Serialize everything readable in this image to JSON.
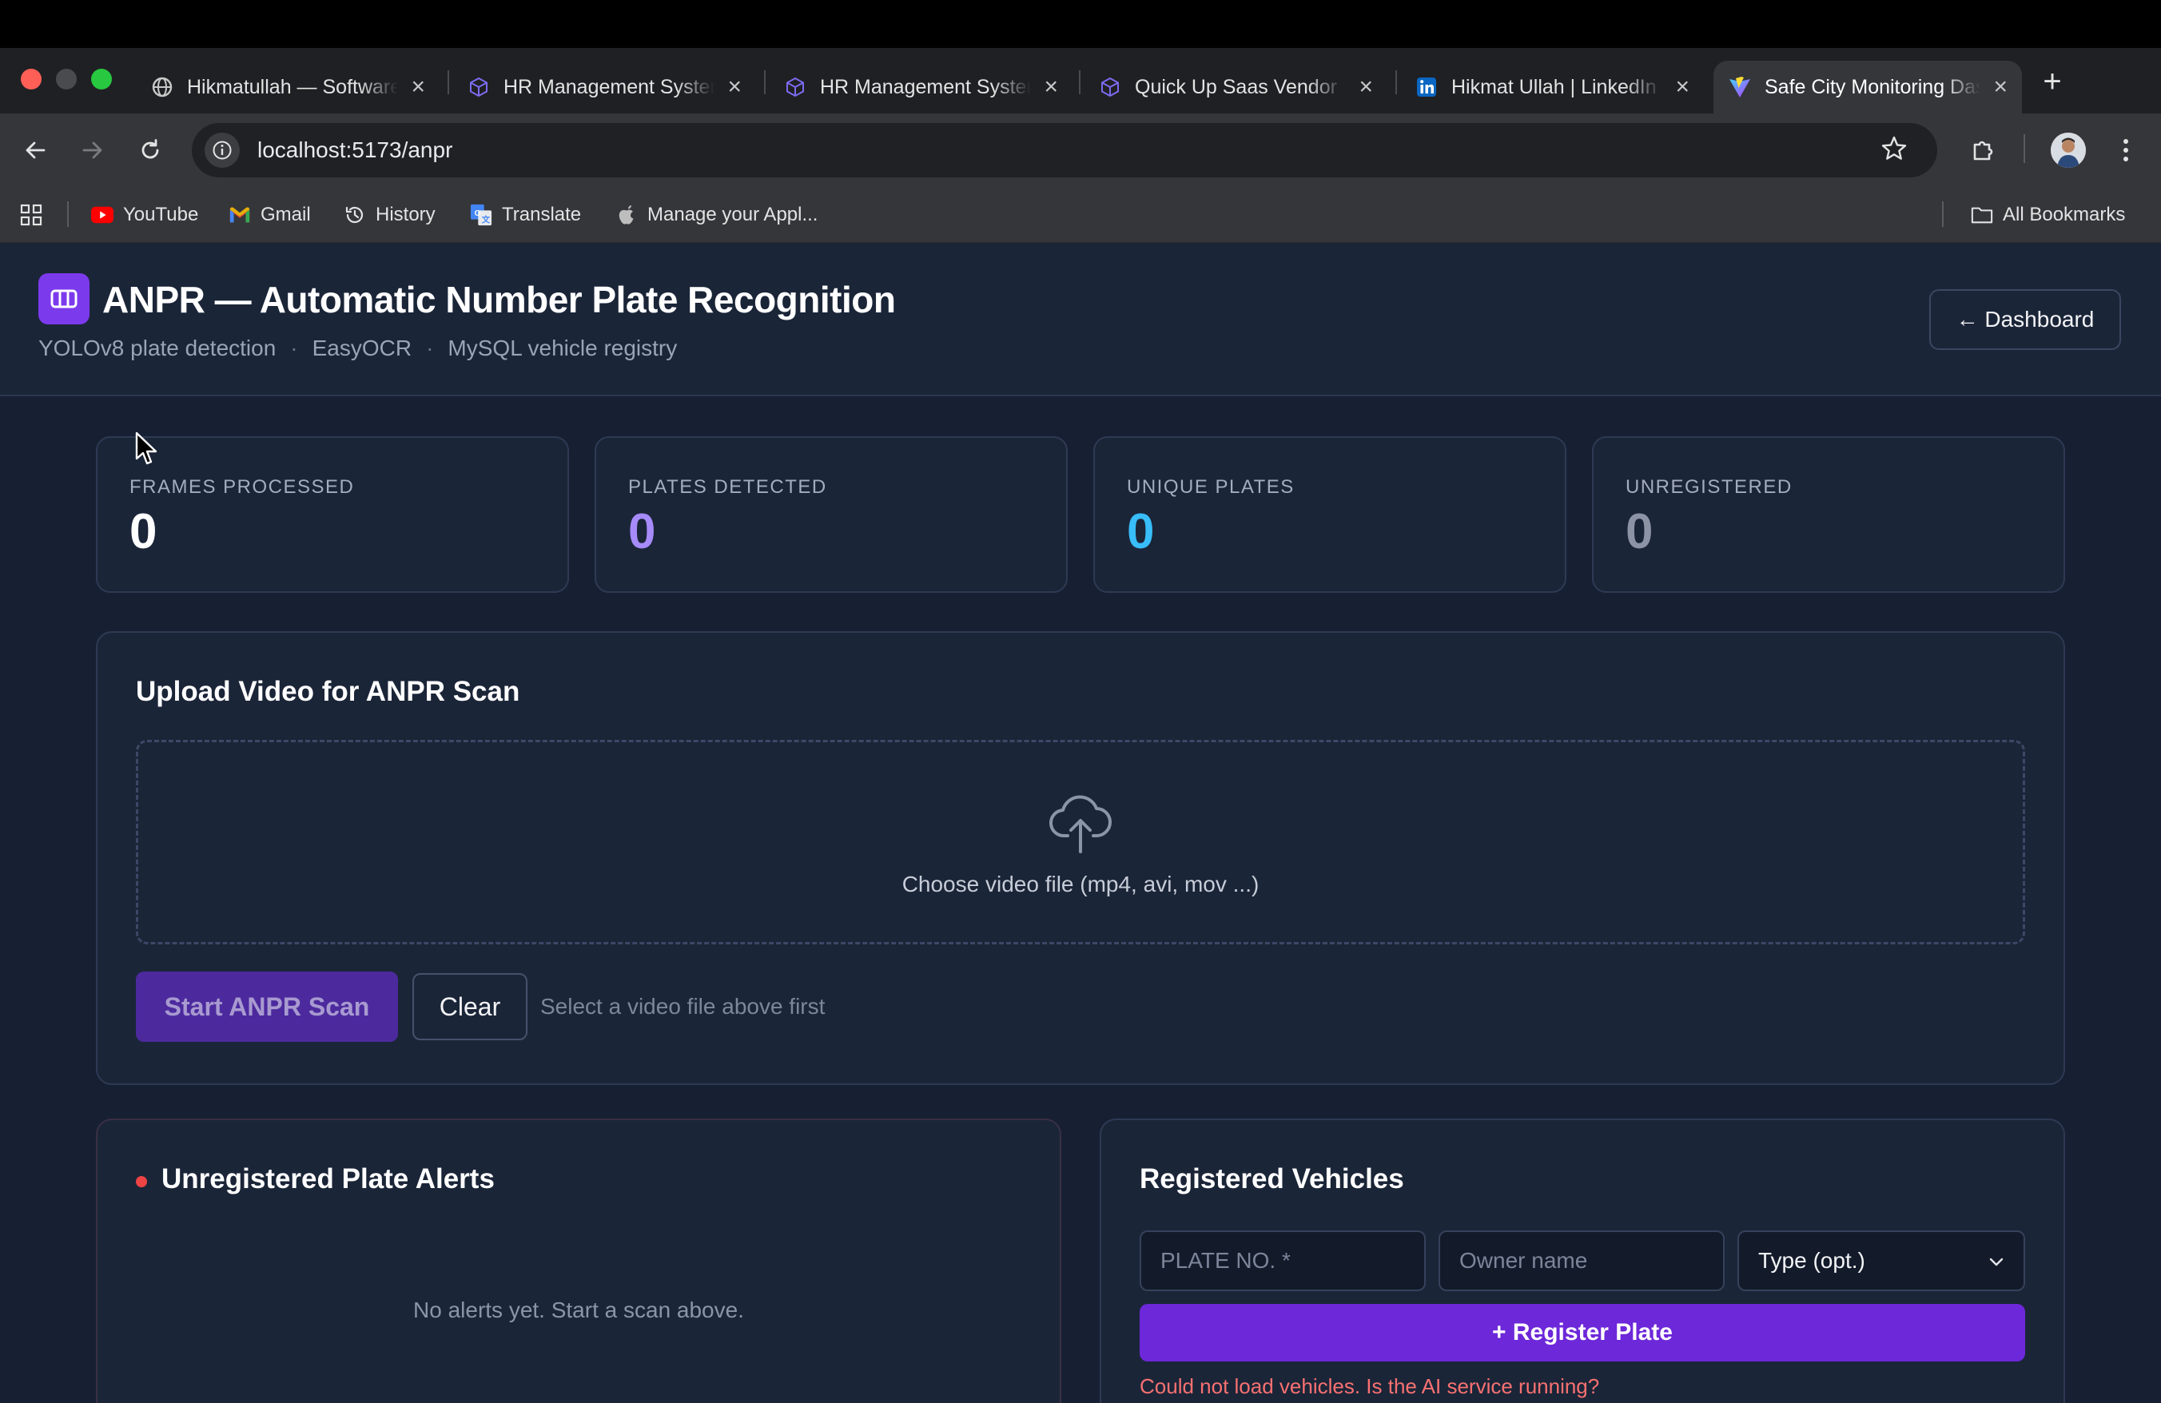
{
  "browser": {
    "tabs": [
      {
        "title": "Hikmatullah — Software Engineer",
        "icon": "globe-icon"
      },
      {
        "title": "HR Management System",
        "icon": "cube-icon"
      },
      {
        "title": "HR Management System",
        "icon": "cube-icon"
      },
      {
        "title": "Quick Up Saas Vendor",
        "icon": "cube-icon"
      },
      {
        "title": "Hikmat Ullah | LinkedIn",
        "icon": "linkedin-icon"
      },
      {
        "title": "Safe City Monitoring Dashboard",
        "icon": "vite-icon",
        "active": true
      }
    ],
    "url": "localhost:5173/anpr",
    "bookmarks": [
      {
        "label": "YouTube",
        "icon": "youtube-icon"
      },
      {
        "label": "Gmail",
        "icon": "gmail-icon"
      },
      {
        "label": "History",
        "icon": "history-icon"
      },
      {
        "label": "Translate",
        "icon": "translate-icon"
      },
      {
        "label": "Manage your Appl...",
        "icon": "apple-icon"
      }
    ],
    "all_bookmarks_label": "All Bookmarks"
  },
  "header": {
    "title": "ANPR — Automatic Number Plate Recognition",
    "subtitle_parts": [
      "YOLOv8 plate detection",
      "EasyOCR",
      "MySQL vehicle registry"
    ],
    "subtitle_separator": "·",
    "dashboard_button": "← Dashboard"
  },
  "stats": [
    {
      "label": "FRAMES PROCESSED",
      "value": "0",
      "color": "#ffffff"
    },
    {
      "label": "PLATES DETECTED",
      "value": "0",
      "color": "#a78bfa"
    },
    {
      "label": "UNIQUE PLATES",
      "value": "0",
      "color": "#38bdf8"
    },
    {
      "label": "UNREGISTERED",
      "value": "0",
      "color": "#8b93a5"
    }
  ],
  "upload": {
    "title": "Upload Video for ANPR Scan",
    "dropzone_text": "Choose video file (mp4, avi, mov ...)",
    "start_button": "Start ANPR Scan",
    "clear_button": "Clear",
    "hint": "Select a video file above first"
  },
  "alerts": {
    "title": "Unregistered Plate Alerts",
    "empty_text": "No alerts yet. Start a scan above."
  },
  "vehicles": {
    "title": "Registered Vehicles",
    "plate_placeholder": "PLATE NO. *",
    "owner_placeholder": "Owner name",
    "type_selected": "Type (opt.)",
    "register_button": "+ Register Plate",
    "error_text": "Could not load vehicles. Is the AI service running?"
  },
  "colors": {
    "accent": "#7c3aed",
    "error": "#f87171",
    "alert_dot": "#ef4444"
  }
}
